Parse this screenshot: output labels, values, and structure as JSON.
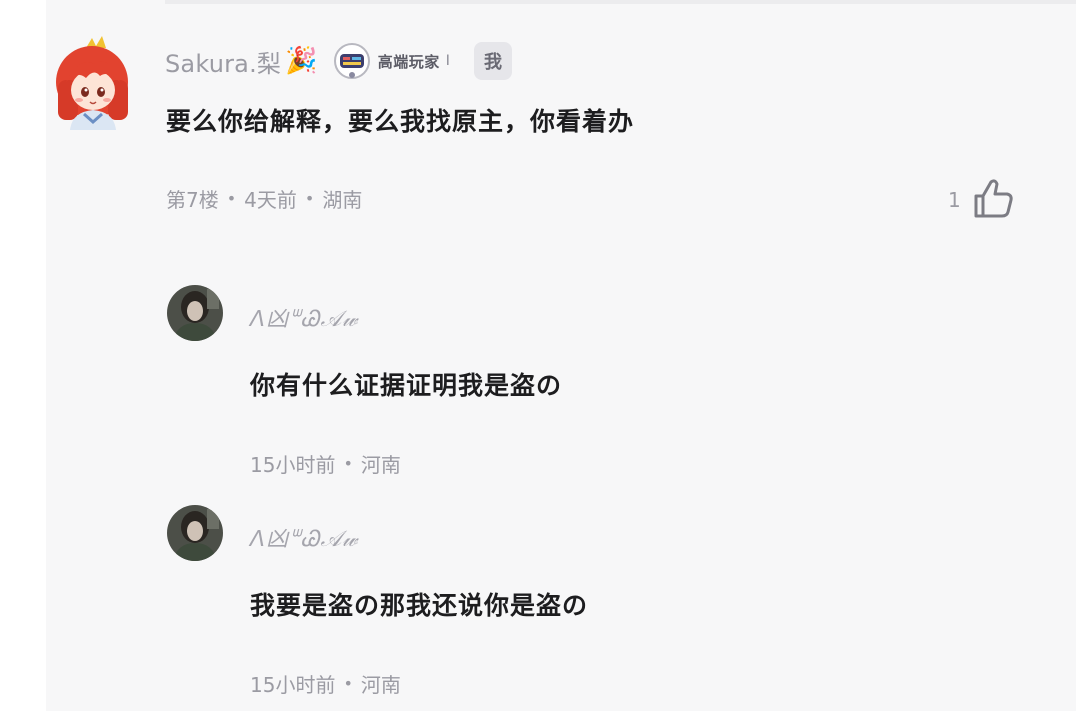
{
  "comment": {
    "author": "Sakura.梨",
    "emoji": "🎉",
    "badge_text": "高端玩家",
    "badge_sep": "I",
    "me_tag": "我",
    "text": "要么你给解释，要么我找原主，你看着办",
    "floor": "第7楼",
    "time": "4天前",
    "location": "湖南",
    "dot": "•",
    "likes": "1"
  },
  "replies": [
    {
      "author": "ᐱ凶ᐜᏊ𝒜𝓌",
      "text": "你有什么证据证明我是盗の",
      "time": "15小时前",
      "location": "河南"
    },
    {
      "author": "ᐱ凶ᐜᏊ𝒜𝓌",
      "text": "我要是盗の那我还说你是盗の",
      "time": "15小时前",
      "location": "河南"
    }
  ],
  "colors": {
    "background": "#f7f7f8",
    "text": "#1d1d1f",
    "muted": "#9b9ba3",
    "avatar_hair": "#e2432f"
  },
  "icons": {
    "like": "thumbs-up-icon",
    "avatar": "anime-girl-avatar",
    "badge": "game-badge-icon"
  }
}
